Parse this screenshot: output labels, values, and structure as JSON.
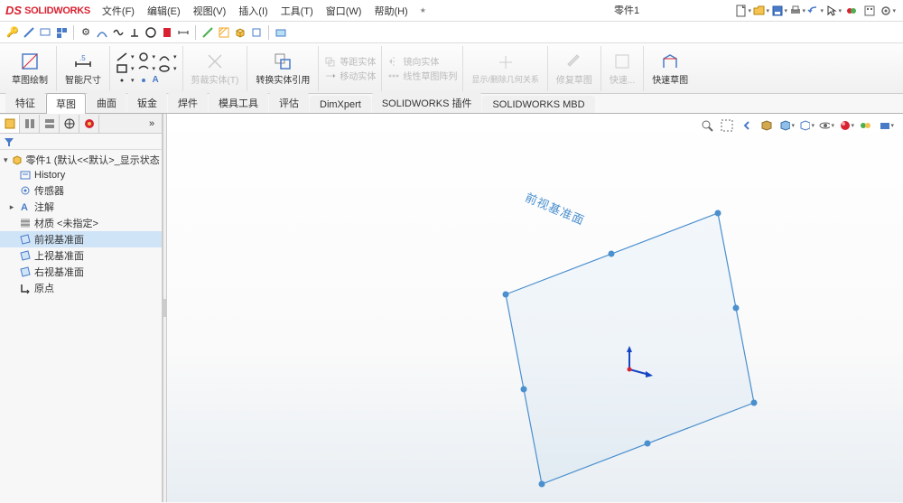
{
  "app": {
    "logo_ds": "DS",
    "logo_sw": "SOLIDWORKS",
    "doc_title": "零件1"
  },
  "menu": {
    "file": "文件(F)",
    "edit": "编辑(E)",
    "view": "视图(V)",
    "insert": "插入(I)",
    "tools": "工具(T)",
    "window": "窗口(W)",
    "help": "帮助(H)"
  },
  "ribbon": {
    "sketch": "草图绘制",
    "smart_dim": "智能尺寸",
    "trim": "剪裁实体(T)",
    "convert": "转换实体引用",
    "offset": "等距实体",
    "move": "移动实体",
    "mirror": "镜向实体",
    "pattern": "线性草图阵列",
    "relations": "显示/删除几何关系",
    "repair": "修复草图",
    "quick": "快速...",
    "rapid_sketch": "快速草图"
  },
  "tabs": {
    "feature": "特征",
    "sketch": "草图",
    "surface": "曲面",
    "sheet": "钣金",
    "weld": "焊件",
    "mold": "模具工具",
    "eval": "评估",
    "dimxpert": "DimXpert",
    "addins": "SOLIDWORKS 插件",
    "mbd": "SOLIDWORKS MBD"
  },
  "tree": {
    "root": "零件1 (默认<<默认>_显示状态",
    "history": "History",
    "sensors": "传感器",
    "annotations": "注解",
    "material": "材质 <未指定>",
    "front_plane": "前视基准面",
    "top_plane": "上视基准面",
    "right_plane": "右视基准面",
    "origin": "原点"
  },
  "viewport": {
    "plane_label": "前视基准面"
  }
}
